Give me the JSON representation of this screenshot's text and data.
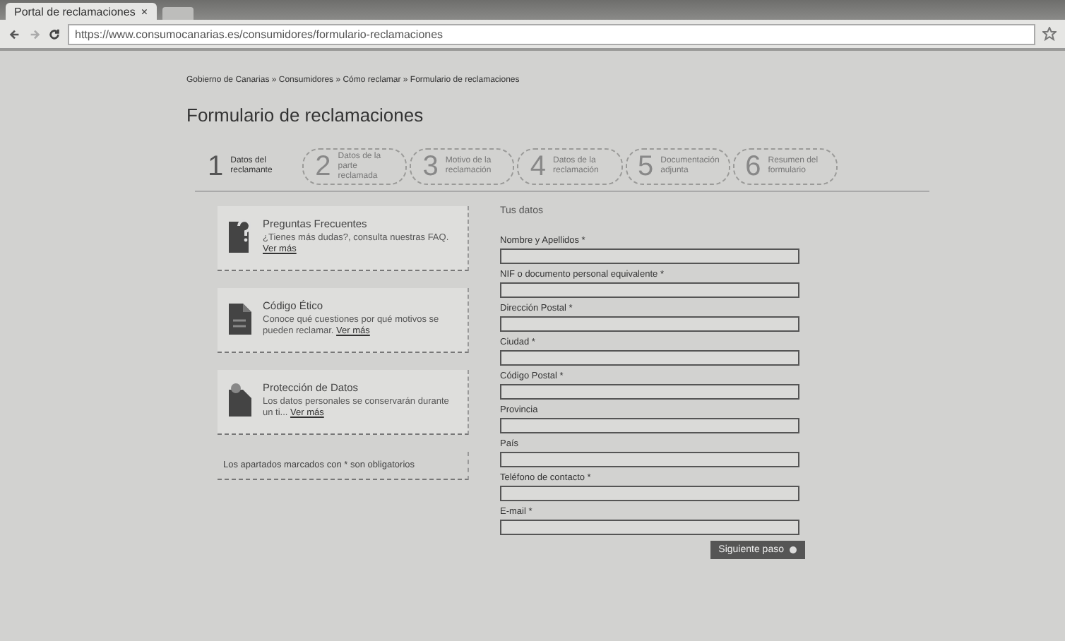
{
  "browser": {
    "tab_title": "Portal de reclamaciones",
    "tab_close": "×",
    "url": "https://www.consumocanarias.es/consumidores/formulario-reclamaciones"
  },
  "breadcrumb": "Gobierno de Canarias » Consumidores » Cómo reclamar » Formulario de reclamaciones",
  "page_title": "Formulario de reclamaciones",
  "steps": [
    {
      "number": "1",
      "label": "Datos del reclamante",
      "selected": true
    },
    {
      "number": "2",
      "label": "Datos de la parte reclamada",
      "selected": false
    },
    {
      "number": "3",
      "label": "Motivo de la reclamación",
      "selected": false
    },
    {
      "number": "4",
      "label": "Datos de la reclamación",
      "selected": false
    },
    {
      "number": "5",
      "label": "Documentación adjunta",
      "selected": false
    },
    {
      "number": "6",
      "label": "Resumen del formulario",
      "selected": false
    }
  ],
  "info_cards": [
    {
      "kind": "question",
      "title": "Preguntas Frecuentes",
      "text": "¿Tienes más dudas?, consulta nuestras FAQ.",
      "link": "Ver más"
    },
    {
      "kind": "document",
      "title": "Código Ético",
      "text": "Conoce qué cuestiones por qué motivos se pueden reclamar.",
      "link": "Ver más"
    },
    {
      "kind": "lock",
      "title": "Protección de Datos",
      "text": "Los datos personales se conservarán durante un ti...",
      "link": "Ver más"
    }
  ],
  "required_note": "Los apartados marcados con * son obligatorios",
  "form": {
    "heading": "Tus datos",
    "fields": [
      {
        "label": "Nombre y Apellidos *"
      },
      {
        "label": "NIF o documento personal equivalente *"
      },
      {
        "label": "Dirección Postal *"
      },
      {
        "label": "Ciudad *"
      },
      {
        "label": "Código Postal *"
      },
      {
        "label": "Provincia"
      },
      {
        "label": "País"
      },
      {
        "label": "Teléfono de contacto *"
      },
      {
        "label": "E-mail *"
      }
    ],
    "next_button": "Siguiente paso"
  }
}
